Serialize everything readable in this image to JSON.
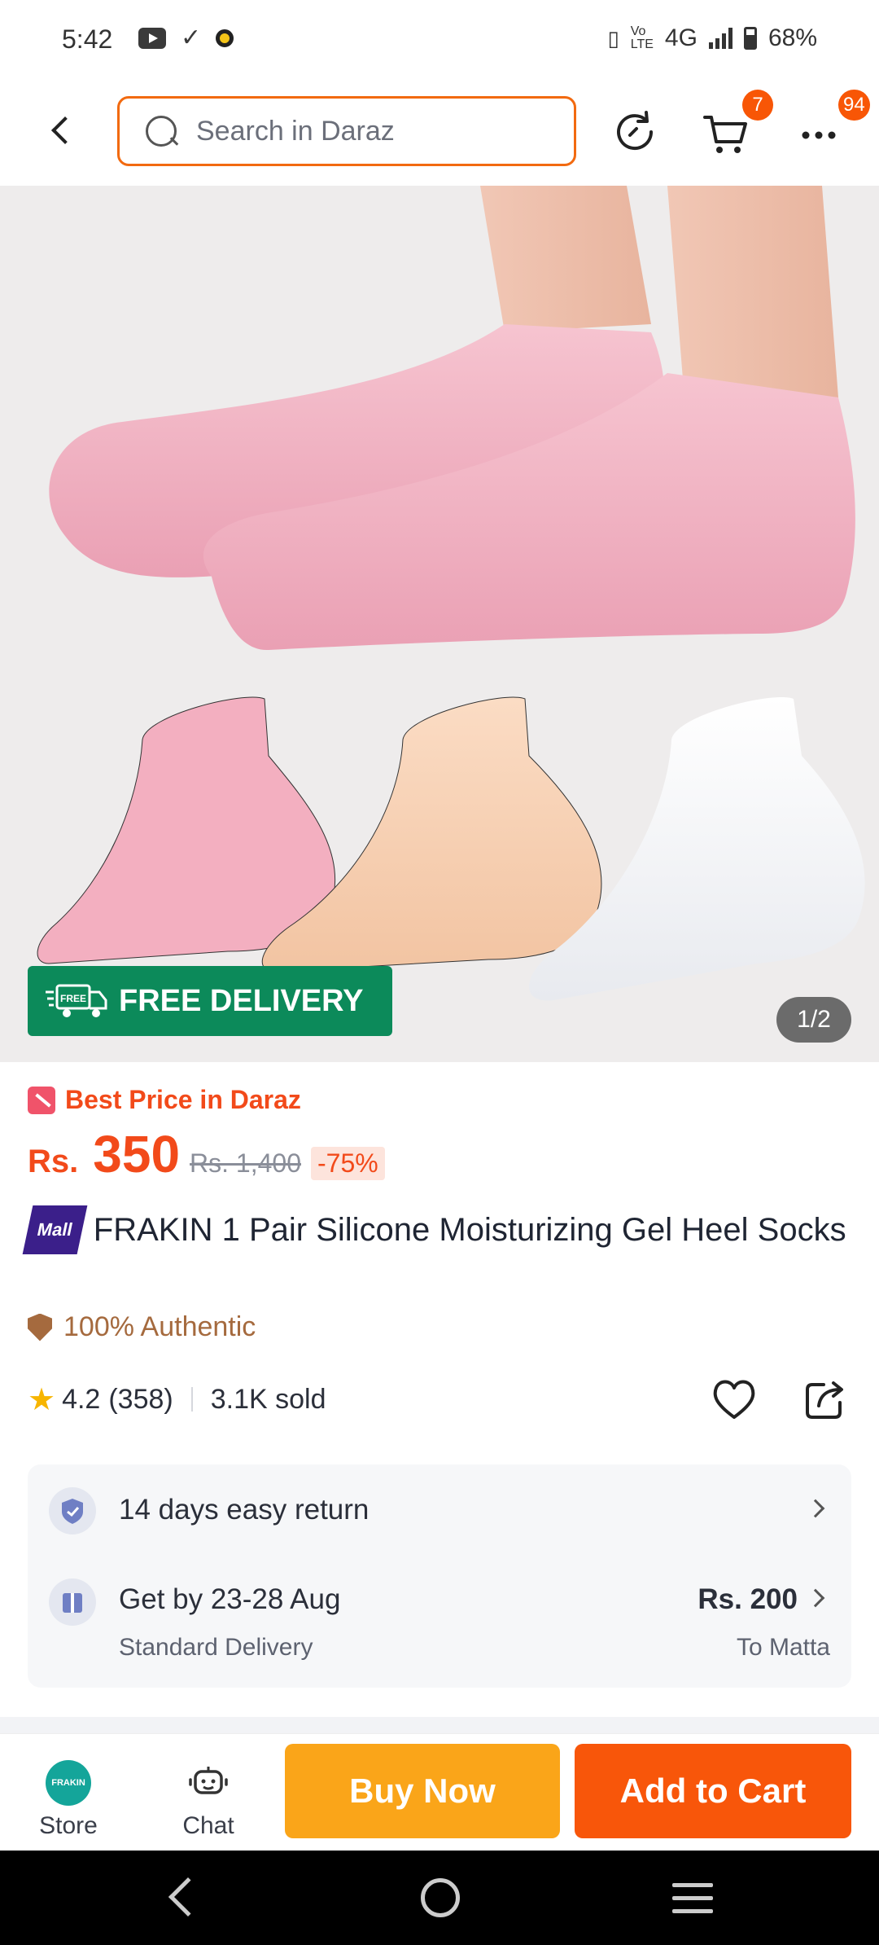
{
  "status_bar": {
    "time": "5:42",
    "network": "4G",
    "battery": "68%",
    "icons": [
      "youtube-icon",
      "download-done-icon",
      "app-dot-icon",
      "vibrate-icon",
      "volte-icon",
      "signal-icon",
      "battery-icon"
    ]
  },
  "header": {
    "search_placeholder": "Search in Daraz",
    "cart_badge": "7",
    "more_badge": "94",
    "icons": [
      "back-icon",
      "search-icon",
      "history-icon",
      "cart-icon",
      "more-icon"
    ]
  },
  "gallery": {
    "free_delivery_label": "FREE DELIVERY",
    "free_icon_text": "FREE",
    "counter": "1/2"
  },
  "product": {
    "best_price_label": "Best Price in Daraz",
    "price_currency": "Rs.",
    "price_value": "350",
    "price_original": "Rs. 1,400",
    "discount": "-75%",
    "mall_badge": "Mall",
    "title": "FRAKIN 1 Pair Silicone Moisturizing Gel Heel Socks",
    "authentic_label": "100% Authentic",
    "rating": "4.2",
    "reviews": "(358)",
    "sold": "3.1K sold"
  },
  "delivery": {
    "return_label": "14 days easy return",
    "delivery_label": "Get by 23-28 Aug",
    "delivery_type": "Standard Delivery",
    "delivery_fee": "Rs. 200",
    "destination": "To Matta"
  },
  "bottom_bar": {
    "store_logo_text": "FRAKIN",
    "store_label": "Store",
    "chat_label": "Chat",
    "buy_now_label": "Buy Now",
    "add_to_cart_label": "Add to Cart"
  },
  "colors": {
    "accent": "#f85606",
    "buy_now": "#faa519",
    "free_delivery": "#0c8a5a",
    "mall": "#3b1f8a",
    "authentic": "#a56a3e"
  }
}
